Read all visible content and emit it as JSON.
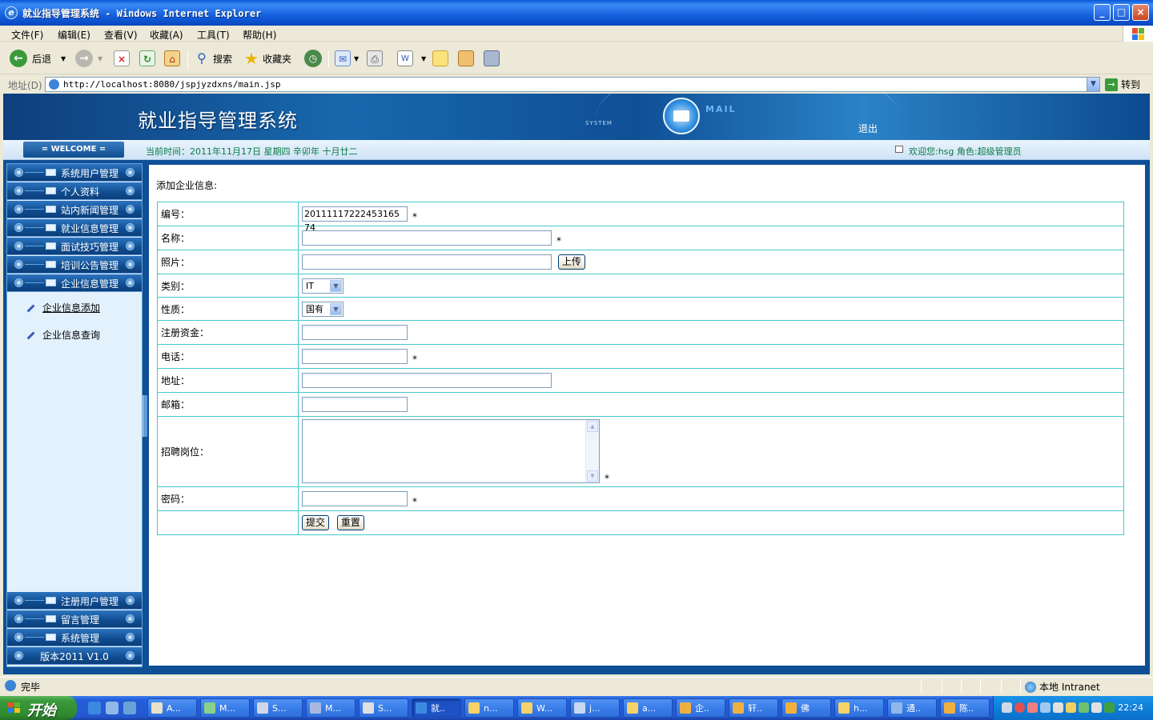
{
  "window": {
    "title": "就业指导管理系统 - Windows Internet Explorer",
    "ie_glyph": "e"
  },
  "menu": [
    "文件(F)",
    "编辑(E)",
    "查看(V)",
    "收藏(A)",
    "工具(T)",
    "帮助(H)"
  ],
  "toolbar": {
    "back_label": "后退",
    "search_label": "搜索",
    "favorites_label": "收藏夹"
  },
  "address": {
    "label": "地址(D)",
    "url": "http://localhost:8080/jspjyzdxns/main.jsp",
    "go_label": "转到"
  },
  "app": {
    "title": "就业指导管理系统",
    "system_text": "SYSTEM",
    "mail_text": "MAIL",
    "logout_label": "退出",
    "welcome_label": "= WELCOME =",
    "current_time": "当前时间：2011年11月17日 星期四 辛卯年 十月廿二",
    "user_info": "欢迎您:hsg 角色:超级管理员"
  },
  "sidebar": {
    "top_items": [
      "系统用户管理",
      "个人资料",
      "站内新闻管理",
      "就业信息管理",
      "面试技巧管理",
      "培训公告管理",
      "企业信息管理"
    ],
    "sub_items": [
      "企业信息添加",
      "企业信息查询"
    ],
    "bottom_items": [
      "注册用户管理",
      "留言管理",
      "系统管理"
    ],
    "version": "版本2011 V1.0"
  },
  "form": {
    "heading": "添加企业信息:",
    "labels": {
      "id": "编号：",
      "name": "名称：",
      "photo": "照片：",
      "category": "类别：",
      "nature": "性质：",
      "capital": "注册资金：",
      "phone": "电话：",
      "address": "地址：",
      "email": "邮箱：",
      "positions": "招聘岗位：",
      "password": "密码："
    },
    "values": {
      "id": "20111117222453165 74",
      "name": "",
      "photo": "",
      "category": "IT",
      "nature": "国有",
      "capital": "",
      "phone": "",
      "address": "",
      "email": "",
      "positions": "",
      "password": ""
    },
    "required_mark": "*",
    "upload_label": "上传",
    "submit_label": "提交",
    "reset_label": "重置",
    "scroll_up": "▲",
    "scroll_down": "▼",
    "dropdown_arrow": "▼"
  },
  "status": {
    "text": "完毕",
    "zone": "本地 Intranet"
  },
  "taskbar": {
    "start_label": "开始",
    "buttons": [
      "A...",
      "M...",
      "S...",
      "M...",
      "S...",
      "就..",
      "n...",
      "W...",
      "j...",
      "a...",
      "企..",
      "轩..",
      "佛",
      "h...",
      "通..",
      "陈.."
    ],
    "clock": "22:24"
  },
  "colors": {
    "header_blue": "#1868ae",
    "table_border": "#44c9cc",
    "time_text": "#0a7a44",
    "taskbar_blue": "#245edb",
    "start_green": "#3a9a3a"
  },
  "icons": [
    "ie-icon",
    "back-icon",
    "forward-icon",
    "stop-icon",
    "refresh-icon",
    "home-icon",
    "search-icon",
    "favorites-star-icon",
    "history-icon",
    "mail-icon",
    "print-icon",
    "edit-icon",
    "folder-icon",
    "envelope-icon",
    "pencil-icon",
    "globe-icon"
  ]
}
